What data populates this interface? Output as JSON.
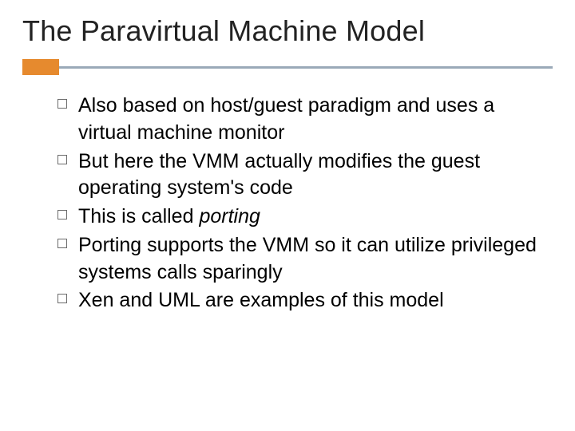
{
  "title": "The Paravirtual Machine Model",
  "bullets": {
    "b1": "Also based on host/guest paradigm and uses a virtual machine monitor",
    "b2": "But here the VMM actually modifies the guest operating system's code",
    "b3_pre": "This is called ",
    "b3_em": "porting",
    "b4": "Porting supports the VMM so it can utilize privileged systems calls sparingly",
    "b5": "Xen and UML are examples of this model"
  }
}
